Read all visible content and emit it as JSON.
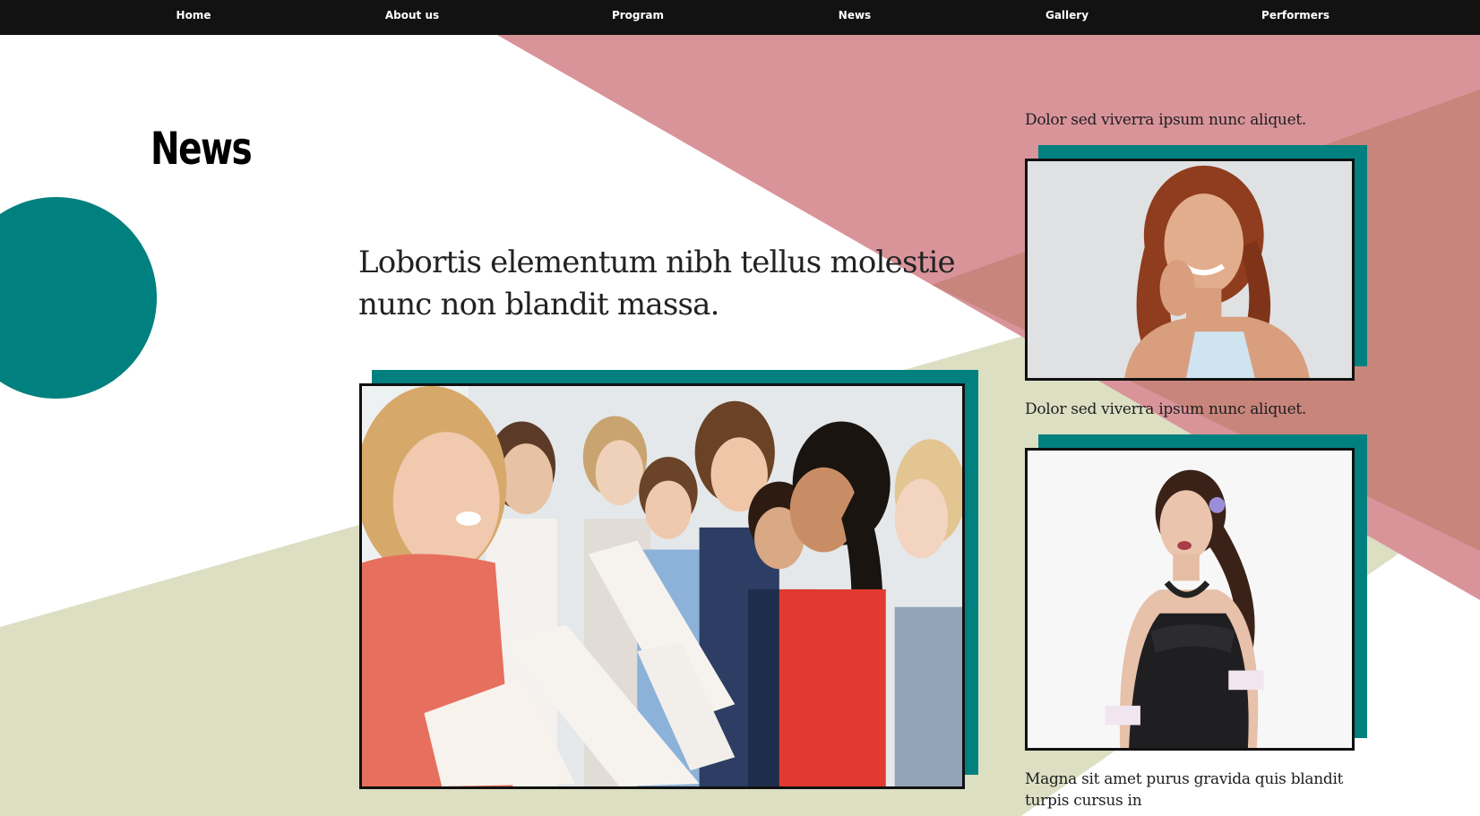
{
  "nav": {
    "items": [
      {
        "label": "Home"
      },
      {
        "label": "About us"
      },
      {
        "label": "Program"
      },
      {
        "label": "News"
      },
      {
        "label": "Gallery"
      },
      {
        "label": "Performers"
      }
    ]
  },
  "page": {
    "title": "News",
    "headline": "Lobortis elementum nibh tellus molestie nunc non blandit massa."
  },
  "sidebar": {
    "items": [
      {
        "caption": "Dolor sed viverra ipsum nunc aliquet."
      },
      {
        "caption": "Dolor sed viverra ipsum nunc aliquet."
      },
      {
        "caption": "Magna sit amet purus gravida quis blandit turpis cursus in"
      }
    ]
  },
  "colors": {
    "navbar": "#121212",
    "teal": "#00807e",
    "pink": "#d9949a",
    "dusty_rose": "#c8857c",
    "sage": "#dcdfc2"
  }
}
